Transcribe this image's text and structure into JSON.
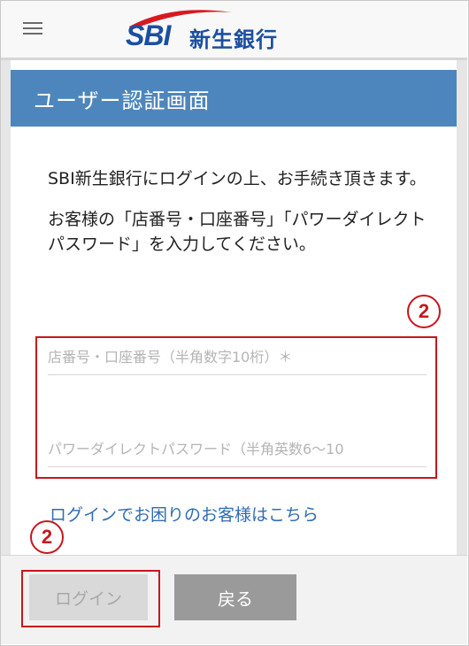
{
  "header": {
    "menu_icon": "hamburger-menu-icon",
    "logo_text": "SBI",
    "bank_name": "新生銀行",
    "brand_color": "#1b4fa0",
    "swoosh_color": "#d71920"
  },
  "panel": {
    "title": "ユーザー認証画面",
    "header_color": "#4d86bd"
  },
  "intro": {
    "line1": "SBI新生銀行にログインの上、お手続き頂きます。",
    "line2": "お客様の「店番号・口座番号」「パワーダイレクトパスワード」を入力してください。"
  },
  "annotations": {
    "marker": "2",
    "marker_color": "#c8161d"
  },
  "form": {
    "account_placeholder": "店番号・口座番号（半角数字10桁）＊",
    "account_value": "",
    "password_placeholder": "パワーダイレクトパスワード（半角英数6〜10",
    "password_value": ""
  },
  "help_link": "ログインでお困りのお客様はこちら",
  "buttons": {
    "login": "ログイン",
    "back": "戻る"
  }
}
